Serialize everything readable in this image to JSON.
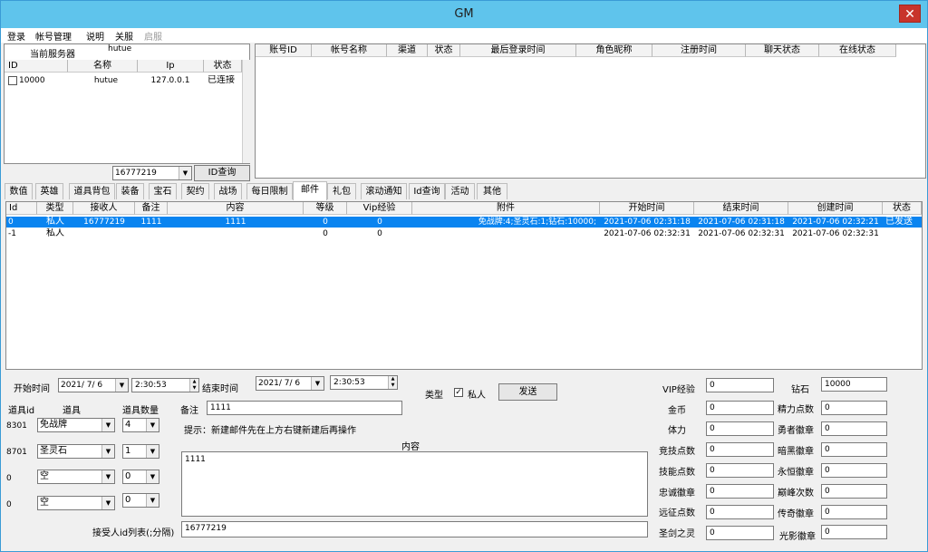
{
  "window": {
    "title": "GM",
    "close_glyph": "✕"
  },
  "menu": [
    {
      "label": "登录",
      "disabled": false
    },
    {
      "label": "帐号管理",
      "disabled": false
    },
    {
      "label": "说明",
      "disabled": false
    },
    {
      "label": "关服",
      "disabled": false
    },
    {
      "label": "启服",
      "disabled": true
    }
  ],
  "server_panel": {
    "current_label": "当前服务器",
    "current_value": "hutue",
    "columns": [
      "ID",
      "名称",
      "Ip",
      "状态"
    ],
    "rows": [
      {
        "id": "10000",
        "name": "hutue",
        "ip": "127.0.0.1",
        "status": "已连接",
        "checked": false
      }
    ],
    "id_input": "16777219",
    "id_query_button": "ID查询"
  },
  "account_table": {
    "columns": [
      "账号ID",
      "帐号名称",
      "渠道",
      "状态",
      "最后登录时间",
      "角色昵称",
      "注册时间",
      "聊天状态",
      "在线状态"
    ]
  },
  "tabs": [
    "数值",
    "英雄",
    "道具背包",
    "装备",
    "宝石",
    "契约",
    "战场",
    "每日限制",
    "邮件",
    "礼包",
    "滚动通知",
    "Id查询",
    "活动",
    "其他"
  ],
  "active_tab": "邮件",
  "mail_table": {
    "columns": [
      "Id",
      "类型",
      "接收人",
      "备注",
      "内容",
      "等级",
      "Vip经验",
      "附件",
      "开始时间",
      "结束时间",
      "创建时间",
      "状态"
    ],
    "rows": [
      {
        "id": "0",
        "type": "私人",
        "receiver": "16777219",
        "note": "1111",
        "content": "1111",
        "level": "0",
        "vip": "0",
        "attach": "免战牌:4;圣灵石:1;钻石:10000;",
        "start": "2021-07-06 02:31:18",
        "end": "2021-07-06 02:31:18",
        "created": "2021-07-06 02:32:21",
        "status": "已发送",
        "selected": true
      },
      {
        "id": "-1",
        "type": "私人",
        "receiver": "",
        "note": "",
        "content": "",
        "level": "0",
        "vip": "0",
        "attach": "",
        "start": "2021-07-06 02:32:31",
        "end": "2021-07-06 02:32:31",
        "created": "2021-07-06 02:32:31",
        "status": "",
        "selected": false
      }
    ]
  },
  "form": {
    "start_label": "开始时间",
    "start_date": "2021/ 7/ 6",
    "start_time": "2:30:53",
    "end_label": "结束时间",
    "end_date": "2021/ 7/ 6",
    "end_time": "2:30:53",
    "type_label": "类型",
    "private_label": "私人",
    "private_checked": true,
    "send_button": "发送",
    "item_id_header": "道具id",
    "item_header": "道具",
    "qty_header": "道具数量",
    "items": [
      {
        "id": "8301",
        "name": "免战牌",
        "qty": "4"
      },
      {
        "id": "8701",
        "name": "圣灵石",
        "qty": "1"
      },
      {
        "id": "0",
        "name": "空",
        "qty": "0"
      },
      {
        "id": "0",
        "name": "空",
        "qty": "0"
      }
    ],
    "note_label": "备注",
    "note_value": "1111",
    "hint": "提示：新建邮件先在上方右键新建后再操作",
    "content_label": "内容",
    "content_value": "1111",
    "receivers_label": "接受人id列表(;分隔)",
    "receivers_value": "16777219"
  },
  "stats_left": [
    {
      "label": "VIP经验",
      "value": "0"
    },
    {
      "label": "金币",
      "value": "0"
    },
    {
      "label": "体力",
      "value": "0"
    },
    {
      "label": "竞技点数",
      "value": "0"
    },
    {
      "label": "技能点数",
      "value": "0"
    },
    {
      "label": "忠诚徽章",
      "value": "0"
    },
    {
      "label": "远征点数",
      "value": "0"
    },
    {
      "label": "圣剑之灵",
      "value": "0"
    }
  ],
  "stats_right": [
    {
      "label": "钻石",
      "value": "10000"
    },
    {
      "label": "精力点数",
      "value": "0"
    },
    {
      "label": "勇者徽章",
      "value": "0"
    },
    {
      "label": "暗黑徽章",
      "value": "0"
    },
    {
      "label": "永恒徽章",
      "value": "0"
    },
    {
      "label": "巅峰次数",
      "value": "0"
    },
    {
      "label": "传奇徽章",
      "value": "0"
    },
    {
      "label": "光影徽章",
      "value": "0"
    }
  ]
}
